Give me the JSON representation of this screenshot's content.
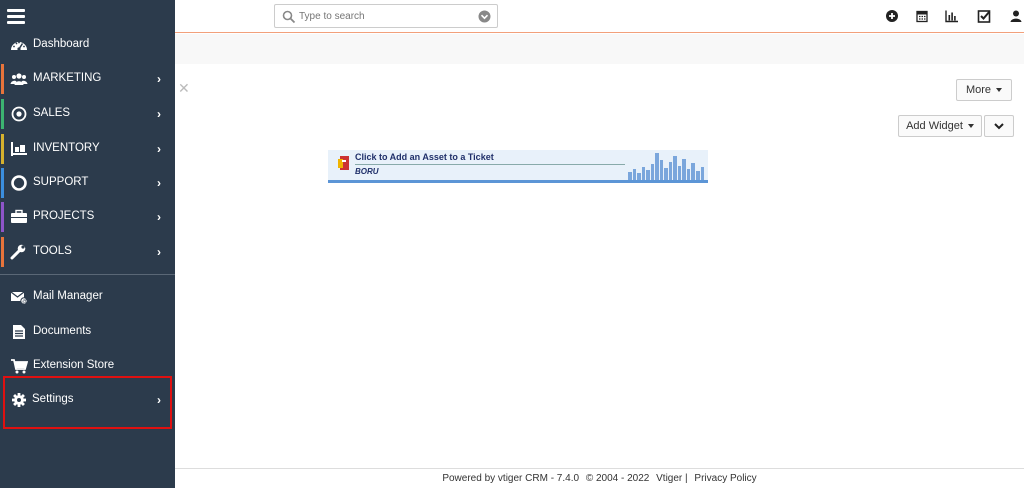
{
  "search": {
    "placeholder": "Type to search"
  },
  "header": {
    "icons": [
      "plus-circle-icon",
      "calendar-icon",
      "bar-chart-icon",
      "checkbox-icon",
      "user-icon"
    ]
  },
  "toolbar": {
    "more_label": "More",
    "add_widget_label": "Add Widget"
  },
  "banner": {
    "text": "Click to Add an Asset to a Ticket",
    "logo": "BORU"
  },
  "sidebar": {
    "items": [
      {
        "label": "Dashboard",
        "icon": "dashboard-icon",
        "color": ""
      },
      {
        "label": "MARKETING",
        "icon": "users-icon",
        "color": "#e8743b"
      },
      {
        "label": "SALES",
        "icon": "target-icon",
        "color": "#3cb371"
      },
      {
        "label": "INVENTORY",
        "icon": "inventory-icon",
        "color": "#d6b12e"
      },
      {
        "label": "SUPPORT",
        "icon": "lifebuoy-icon",
        "color": "#3b8ede"
      },
      {
        "label": "PROJECTS",
        "icon": "briefcase-icon",
        "color": "#8e55c9"
      },
      {
        "label": "TOOLS",
        "icon": "wrench-icon",
        "color": "#e8743b"
      },
      {
        "label": "Mail Manager",
        "icon": "mail-icon",
        "color": ""
      },
      {
        "label": "Documents",
        "icon": "document-icon",
        "color": ""
      },
      {
        "label": "Extension Store",
        "icon": "cart-icon",
        "color": ""
      },
      {
        "label": "Settings",
        "icon": "gear-icon",
        "color": ""
      }
    ]
  },
  "footer": {
    "powered": "Powered by vtiger CRM - 7.4.0",
    "copyright": "© 2004 - 2022",
    "company": "Vtiger |",
    "privacy": "Privacy Policy"
  }
}
